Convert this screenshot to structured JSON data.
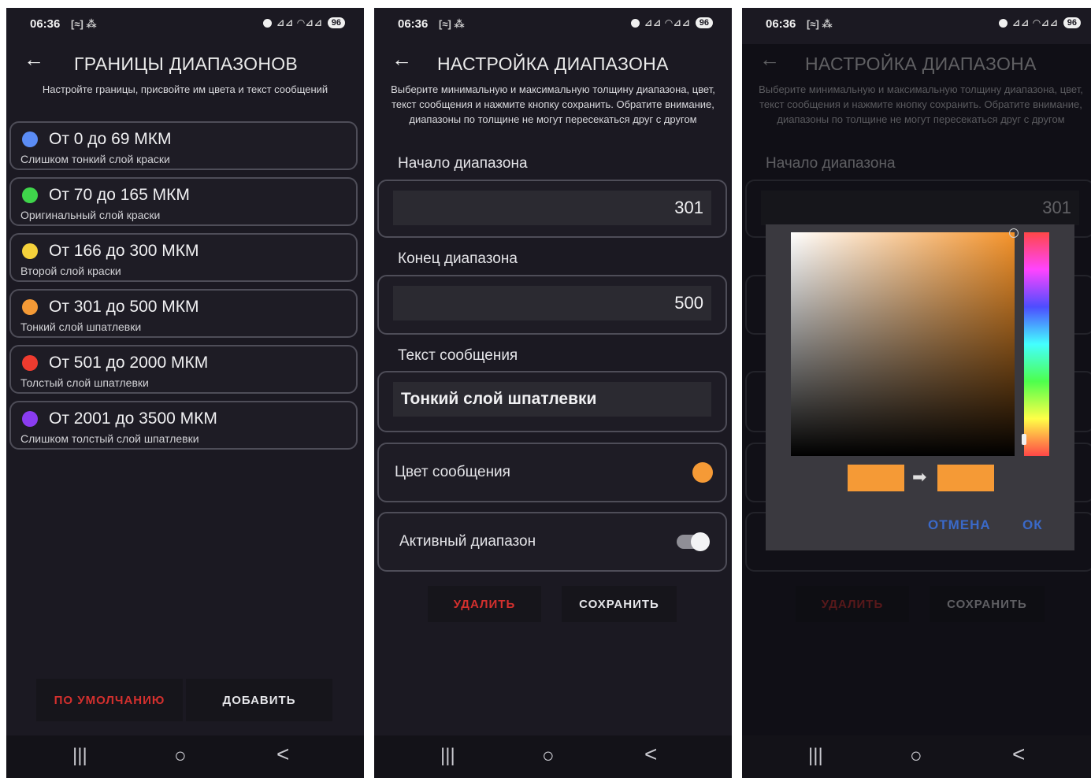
{
  "status": {
    "time": "06:36",
    "extra": "[≈] ⁂",
    "signal": "⊿⊿ ◠⊿⊿",
    "battery": "96"
  },
  "nav": {
    "recent": "|||",
    "home": "○",
    "back": "<"
  },
  "screen1": {
    "back": "←",
    "title": "ГРАНИЦЫ ДИАПАЗОНОВ",
    "subtitle": "Настройте границы, присвойте им цвета и текст сообщений",
    "ranges": [
      {
        "title": "От 0 до 69 МКМ",
        "sub": "Слишком тонкий слой краски",
        "color": "#5b8cf5"
      },
      {
        "title": "От 70 до 165 МКМ",
        "sub": "Оригинальный слой краски",
        "color": "#3fd54b"
      },
      {
        "title": "От 166 до 300 МКМ",
        "sub": "Второй слой краски",
        "color": "#f5d13b"
      },
      {
        "title": "От 301 до 500 МКМ",
        "sub": "Тонкий слой шпатлевки",
        "color": "#f59a36"
      },
      {
        "title": "От 501 до 2000 МКМ",
        "sub": "Толстый слой шпатлевки",
        "color": "#ef3b2f"
      },
      {
        "title": "От 2001 до 3500 МКМ",
        "sub": "Слишком толстый слой шпатлевки",
        "color": "#8a3cf0"
      }
    ],
    "default_btn": "ПО УМОЛЧАНИЮ",
    "add_btn": "ДОБАВИТЬ"
  },
  "screen2": {
    "back": "←",
    "title": "НАСТРОЙКА ДИАПАЗОНА",
    "subtitle": "Выберите минимальную и максимальную толщину диапазона, цвет, текст сообщения и нажмите кнопку сохранить. Обратите внимание, диапазоны по толщине не могут пересекаться друг с другом",
    "start_label": "Начало диапазона",
    "start_value": "301",
    "end_label": "Конец диапазона",
    "end_value": "500",
    "msg_label": "Текст сообщения",
    "msg_value": "Тонкий слой шпатлевки",
    "color_label": "Цвет сообщения",
    "color_value": "#f59a36",
    "active_label": "Активный диапазон",
    "active_on": true,
    "delete_btn": "УДАЛИТЬ",
    "save_btn": "СОХРАНИТЬ"
  },
  "screen3": {
    "dialog": {
      "old_color": "#f59a36",
      "new_color": "#f59a36",
      "arrow": "➡",
      "cancel": "ОТМЕНА",
      "ok": "ОК"
    }
  }
}
